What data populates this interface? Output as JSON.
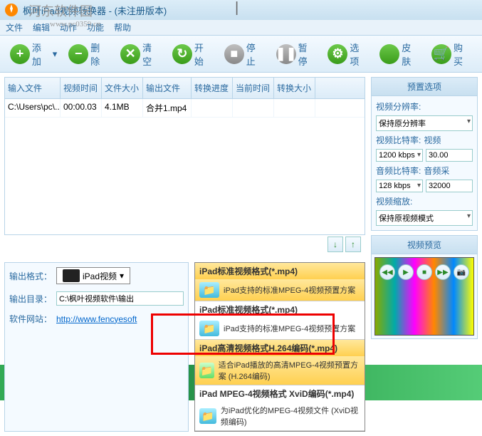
{
  "title": "枫叶iPad视频转换器 - (未注册版本)",
  "watermark": {
    "text": "河东软件园",
    "url": "www.pc0359.cn"
  },
  "menu": [
    "文件",
    "编辑",
    "动作",
    "功能",
    "帮助"
  ],
  "toolbar": {
    "add": "添加",
    "delete": "删除",
    "clear": "清空",
    "start": "开始",
    "stop": "停止",
    "pause": "暂停",
    "options": "选项",
    "skin": "皮肤",
    "buy": "购买"
  },
  "columns": [
    "输入文件",
    "视频时间",
    "文件大小",
    "输出文件",
    "转换进度",
    "当前时间",
    "转换大小"
  ],
  "rows": [
    {
      "input": "C:\\Users\\pc\\...",
      "vtime": "00:00.03",
      "fsize": "4.1MB",
      "out": "合并1.mp4",
      "prog": "",
      "ctime": "",
      "csize": ""
    }
  ],
  "presets": {
    "title": "预置选项",
    "resolution_label": "视频分辨率:",
    "resolution": "保持原分辨率",
    "vbitrate_label": "视频比特率:",
    "vbitrate": "1200 kbps",
    "vextra_label": "视频",
    "vextra": "30.00",
    "abitrate_label": "音频比特率:",
    "abitrate": "128 kbps",
    "aextra_label": "音频采",
    "aextra": "32000",
    "scale_label": "视频缩放:",
    "scale": "保持原视频模式"
  },
  "preview": {
    "title": "视频预览"
  },
  "output": {
    "format_label": "输出格式：",
    "format_btn": "iPad视频",
    "dir_label": "输出目录：",
    "dir": "C:\\枫叶视频软件\\输出",
    "site_label": "软件网站：",
    "site": "http://www.fencyesoft"
  },
  "formats": [
    {
      "title": "iPad标准视频格式(*.mp4)",
      "desc": "iPad支持的标准MPEG-4视频预置方案",
      "sel": true,
      "ico": "b"
    },
    {
      "title": "iPad标准视频格式(*.mp4)",
      "desc": "iPad支持的标准MPEG-4视频预置方案",
      "sel": false,
      "ico": "b"
    },
    {
      "title": "iPad高清视频格式H.264编码(*.mp4)",
      "desc": "适合iPad播放的高清MPEG-4视频预置方案 (H.264编码)",
      "sel": true,
      "ico": "g"
    },
    {
      "title": "iPad MPEG-4视频格式 XviD编码(*.mp4)",
      "desc": "为iPad优化的MPEG-4视频文件 (XviD视频编码)",
      "sel": false,
      "ico": "b"
    }
  ]
}
